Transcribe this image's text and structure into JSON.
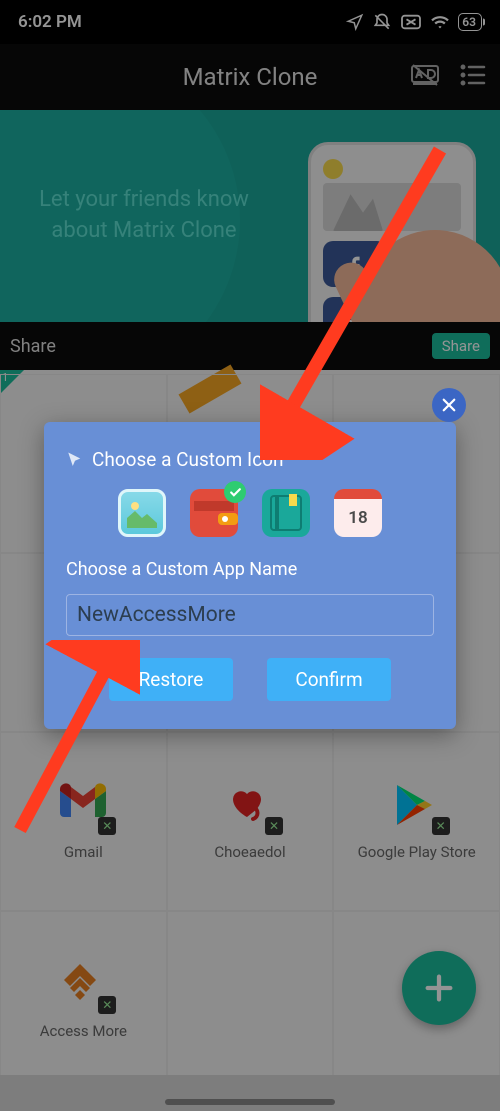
{
  "status": {
    "time": "6:02 PM",
    "battery": "63"
  },
  "header": {
    "title": "Matrix Clone"
  },
  "banner": {
    "line1": "Let your friends know",
    "line2": "about Matrix Clone"
  },
  "shareBar": {
    "label": "Share",
    "button": "Share"
  },
  "grid": {
    "badge": "1",
    "items": [
      {
        "label": "Gmail"
      },
      {
        "label": "Choeaedol"
      },
      {
        "label": "Google Play Store"
      },
      {
        "label": "Access More"
      }
    ]
  },
  "dialog": {
    "title": "Choose a Custom Icon",
    "appNameLabel": "Choose a Custom App Name",
    "inputValue": "NewAccessMore",
    "calDay": "18",
    "restore": "Restore",
    "confirm": "Confirm"
  }
}
